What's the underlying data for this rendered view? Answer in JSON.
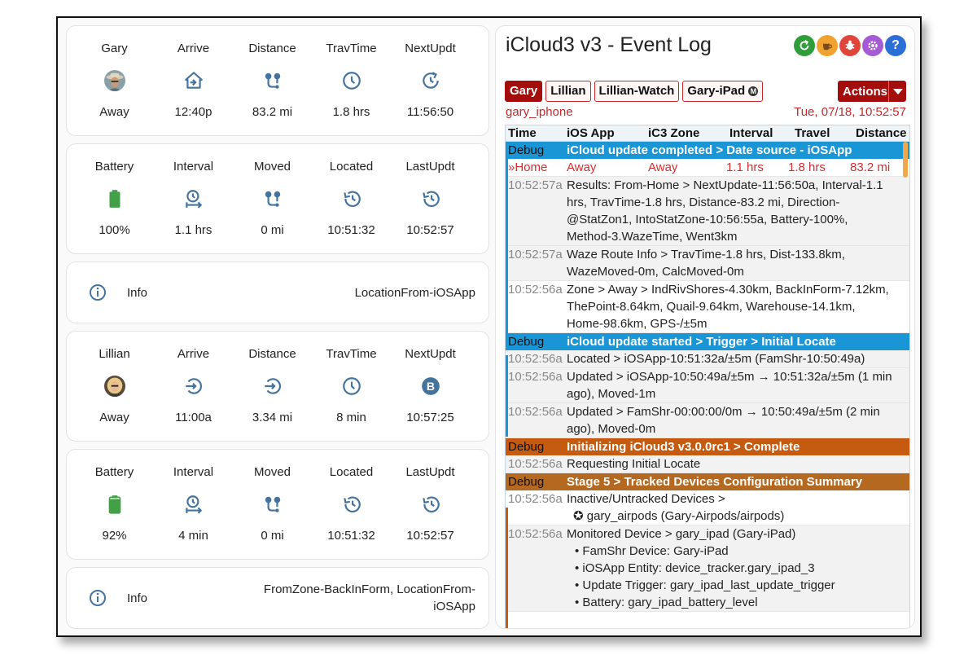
{
  "person1": {
    "row1": {
      "name": "Gary",
      "arrive_label": "Arrive",
      "distance_label": "Distance",
      "travtime_label": "TravTime",
      "nextupdt_label": "NextUpdt",
      "zone": "Away",
      "arrive": "12:40p",
      "distance": "83.2 mi",
      "travtime": "1.8 hrs",
      "nextupdt": "11:56:50"
    },
    "row2": {
      "battery_label": "Battery",
      "interval_label": "Interval",
      "moved_label": "Moved",
      "located_label": "Located",
      "lastupdt_label": "LastUpdt",
      "battery": "100%",
      "battery_level": 1.0,
      "interval": "1.1 hrs",
      "moved": "0 mi",
      "located": "10:51:32",
      "lastupdt": "10:52:57"
    },
    "info": {
      "label": "Info",
      "value": "LocationFrom-iOSApp"
    }
  },
  "person2": {
    "row1": {
      "name": "Lillian",
      "arrive_label": "Arrive",
      "distance_label": "Distance",
      "travtime_label": "TravTime",
      "nextupdt_label": "NextUpdt",
      "zone": "Away",
      "arrive": "11:00a",
      "distance": "3.34 mi",
      "travtime": "8 min",
      "nextupdt": "10:57:25",
      "nextupdt_badge": "B"
    },
    "row2": {
      "battery_label": "Battery",
      "interval_label": "Interval",
      "moved_label": "Moved",
      "located_label": "Located",
      "lastupdt_label": "LastUpdt",
      "battery": "92%",
      "battery_level": 0.92,
      "interval": "4 min",
      "moved": "0 mi",
      "located": "10:51:32",
      "lastupdt": "10:52:57"
    },
    "info": {
      "label": "Info",
      "value_line1": "FromZone-BackInForm, LocationFrom-",
      "value_line2": "iOSApp"
    }
  },
  "log": {
    "title": "iCloud3 v3 - Event Log",
    "header_icons": [
      "refresh-icon",
      "coffee-icon",
      "bug-icon",
      "settings-icon",
      "help-icon"
    ],
    "header_icon_help_glyph": "?",
    "tabs": [
      "Gary",
      "Lillian",
      "Lillian-Watch",
      "Gary-iPad"
    ],
    "tab_badge": "M",
    "actions_label": "Actions",
    "device": "gary_iphone",
    "timestamp": "Tue, 07/18, 10:52:57",
    "columns": [
      "Time",
      "iOS App",
      "iC3 Zone",
      "Interval",
      "Travel",
      "Distance"
    ],
    "rows": [
      {
        "t": "Debug",
        "m": "iCloud update completed > Date source - iOSApp"
      },
      {
        "t": "»Home",
        "c1": "Away",
        "c2": "Away",
        "c3": "1.1 hrs",
        "c4": "1.8 hrs",
        "c5": "83.2 mi"
      },
      {
        "t": "10:52:57a",
        "m": "Results: From-Home > NextUpdate-11:56:50a, Interval-1.1 hrs, TravTime-1.8 hrs, Distance-83.2 mi, Direction-@StatZon1, IntoStatZone-10:56:55a, Battery-100%, Method-3.WazeTime, Went3km"
      },
      {
        "t": "10:52:57a",
        "m": "Waze Route Info > TravTime-1.8 hrs, Dist-133.8km, WazeMoved-0m, CalcMoved-0m"
      },
      {
        "t": "10:52:56a",
        "m": "Zone > Away > IndRivShores-4.30km, BackInForm-7.12km, ThePoint-8.64km, Quail-9.64km, Warehouse-14.1km, Home-98.6km, GPS-/±5m"
      },
      {
        "t": "Debug",
        "m": "iCloud update started > Trigger > Initial Locate"
      },
      {
        "t": "10:52:56a",
        "m": "Located > iOSApp-10:51:32a/±5m (FamShr-10:50:49a)"
      },
      {
        "t": "10:52:56a",
        "m": "Updated > iOSApp-10:50:49a/±5m → 10:51:32a/±5m (1 min ago), Moved-1m"
      },
      {
        "t": "10:52:56a",
        "m": "Updated > FamShr-00:00:00/0m → 10:50:49a/±5m (2 min ago), Moved-0m"
      },
      {
        "t": "Debug",
        "m": "Initializing iCloud3 v3.0.0rc1 > Complete"
      },
      {
        "t": "10:52:56a",
        "m": "Requesting Initial Locate"
      },
      {
        "t": "Debug",
        "m": "Stage 5 > Tracked Devices Configuration Summary"
      },
      {
        "t": "10:52:56a",
        "m": "Inactive/Untracked Devices >",
        "sub": "✪ gary_airpods (Gary-Airpods/airpods)"
      },
      {
        "t": "10:52:56a",
        "m": "Monitored Device > gary_ipad (Gary-iPad)",
        "bullets": [
          "FamShr Device: Gary-iPad",
          "iOSApp Entity: device_tracker.gary_ipad_3",
          "Update Trigger: gary_ipad_last_update_trigger",
          "Battery: gary_ipad_battery_level"
        ]
      }
    ]
  }
}
